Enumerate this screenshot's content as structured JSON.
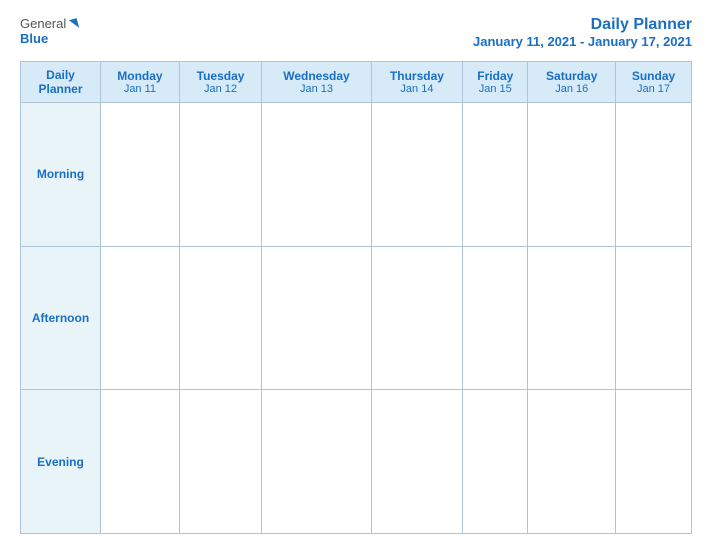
{
  "logo": {
    "general": "General",
    "blue": "Blue"
  },
  "title": {
    "main": "Daily Planner",
    "date_range": "January 11, 2021 - January 17, 2021"
  },
  "table": {
    "header": {
      "label": "Daily\nPlanner",
      "days": [
        {
          "name": "Monday",
          "date": "Jan 11"
        },
        {
          "name": "Tuesday",
          "date": "Jan 12"
        },
        {
          "name": "Wednesday",
          "date": "Jan 13"
        },
        {
          "name": "Thursday",
          "date": "Jan 14"
        },
        {
          "name": "Friday",
          "date": "Jan 15"
        },
        {
          "name": "Saturday",
          "date": "Jan 16"
        },
        {
          "name": "Sunday",
          "date": "Jan 17"
        }
      ]
    },
    "rows": [
      {
        "label": "Morning"
      },
      {
        "label": "Afternoon"
      },
      {
        "label": "Evening"
      }
    ]
  }
}
